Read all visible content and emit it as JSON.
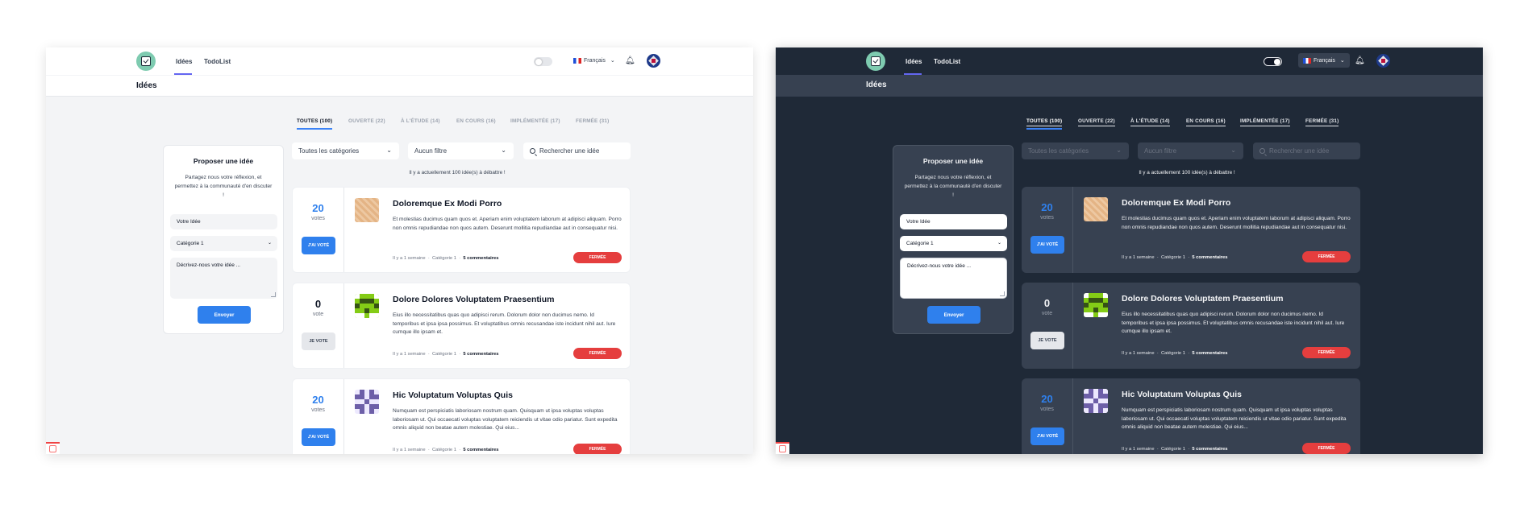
{
  "nav": {
    "ideas": "Idées",
    "todolist": "TodoList",
    "language": "Français"
  },
  "page": {
    "title": "Idées"
  },
  "tabs": [
    {
      "label": "TOUTES (100)"
    },
    {
      "label": "OUVERTE (22)"
    },
    {
      "label": "À L'ÉTUDE (14)"
    },
    {
      "label": "EN COURS (16)"
    },
    {
      "label": "IMPLÉMENTÉE (17)"
    },
    {
      "label": "FERMÉE (31)"
    }
  ],
  "propose": {
    "title": "Proposer une idée",
    "description": "Partagez nous votre réflexion, et permettez à la communauté d'en discuter !",
    "idea_placeholder": "Votre Idée",
    "category_value": "Catégorie 1",
    "description_placeholder": "Décrivez-nous votre idée ...",
    "send": "Envoyer"
  },
  "filters": {
    "category": "Toutes les catégories",
    "filter": "Aucun filtre",
    "search_placeholder": "Rechercher une idée"
  },
  "count_text": "Il y a actuellement 100 idée(s) à débattre !",
  "ideas": [
    {
      "votes": "20",
      "vote_word": "votes",
      "button": "J'AI VOTÉ",
      "title": "Doloremque Ex Modi Porro",
      "description": "Et molestias ducimus quam quos et. Aperiam enim voluptatem laborum at adipisci aliquam. Porro non omnis repudiandae non quos autem. Deserunt mollitia repudiandae aut in consequatur nisi.",
      "time": "Il y a 1 semaine",
      "category": "Catégorie 1",
      "comments": "5 commentaires",
      "status": "FERMÉE"
    },
    {
      "votes": "0",
      "vote_word": "vote",
      "button": "JE VOTE",
      "title": "Dolore Dolores Voluptatem Praesentium",
      "description": "Eius illo necessitatibus quas quo adipisci rerum. Dolorum dolor non ducimus nemo. Id temporibus et ipsa ipsa possimus. Et voluptatibus omnis recusandae iste incidunt nihil aut. Iure cumque illo ipsam et.",
      "time": "Il y a 1 semaine",
      "category": "Catégorie 1",
      "comments": "5 commentaires",
      "status": "FERMÉE"
    },
    {
      "votes": "20",
      "vote_word": "votes",
      "button": "J'AI VOTÉ",
      "title": "Hic Voluptatum Voluptas Quis",
      "description": "Numquam est perspiciatis laboriosam nostrum quam. Quisquam ut ipsa voluptas voluptas laboriosam ut. Qui occaecati voluptas voluptatem reiciendis ut vitae odio pariatur. Sunt expedita omnis aliquid non beatae autem molestiae. Qui eius...",
      "time": "Il y a 1 semaine",
      "category": "Catégorie 1",
      "comments": "5 commentaires",
      "status": "FERMÉE"
    }
  ],
  "colors": {
    "primary": "#2f80ed",
    "status_closed": "#e53e3e",
    "dark_bg": "#1f2937",
    "dark_card": "#374151",
    "light_bg": "#f3f4f6"
  }
}
